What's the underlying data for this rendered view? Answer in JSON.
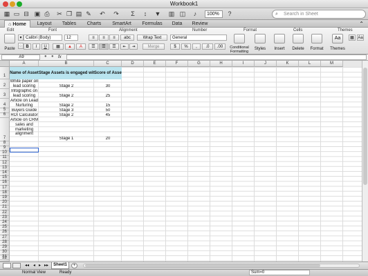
{
  "window": {
    "title": "Workbook1"
  },
  "toolbar": {
    "zoom": "100%",
    "search_placeholder": "Search in Sheet"
  },
  "tabs": [
    "Home",
    "Layout",
    "Tables",
    "Charts",
    "SmartArt",
    "Formulas",
    "Data",
    "Review"
  ],
  "ribbon": {
    "groups": [
      "Edit",
      "Font",
      "Alignment",
      "Number",
      "Format",
      "Cells",
      "Themes"
    ],
    "paste": "Paste",
    "font_name": "Calibri (Body)",
    "font_size": "12",
    "wrap_text": "Wrap Text",
    "merge": "Merge",
    "number_format": "General",
    "conditional_formatting": "Conditional Formatting",
    "styles": "Styles",
    "insert": "Insert",
    "delete": "Delete",
    "format": "Format",
    "themes": "Themes"
  },
  "formula_bar": {
    "name_box": "A9",
    "fx": "fx",
    "value": ""
  },
  "columns": [
    "A",
    "B",
    "C",
    "D",
    "E",
    "F",
    "G",
    "H",
    "I",
    "J",
    "K",
    "L",
    "M"
  ],
  "table": {
    "headers": [
      "Name of Asset",
      "Stage Assets is engaged with",
      "Score of Asset"
    ],
    "rows": [
      {
        "name": "White paper on lead scoring",
        "stage": "Stage 2",
        "score": "30"
      },
      {
        "name": "Infographic on lead scoring",
        "stage": "Stage 2",
        "score": "25"
      },
      {
        "name": "Article on Lead Nurturing",
        "stage": "Stage 2",
        "score": "15"
      },
      {
        "name": "Buyers Guide",
        "stage": "Stage 3",
        "score": "50"
      },
      {
        "name": "ROI Calculator",
        "stage": "Stage 2",
        "score": "45"
      },
      {
        "name": "Article on CRM sales and marketing alignment",
        "stage": "Stage 1",
        "score": "20"
      }
    ]
  },
  "sheets": [
    "Sheet1"
  ],
  "status": {
    "view": "Normal View",
    "state": "Ready",
    "sum": "Sum=0"
  }
}
